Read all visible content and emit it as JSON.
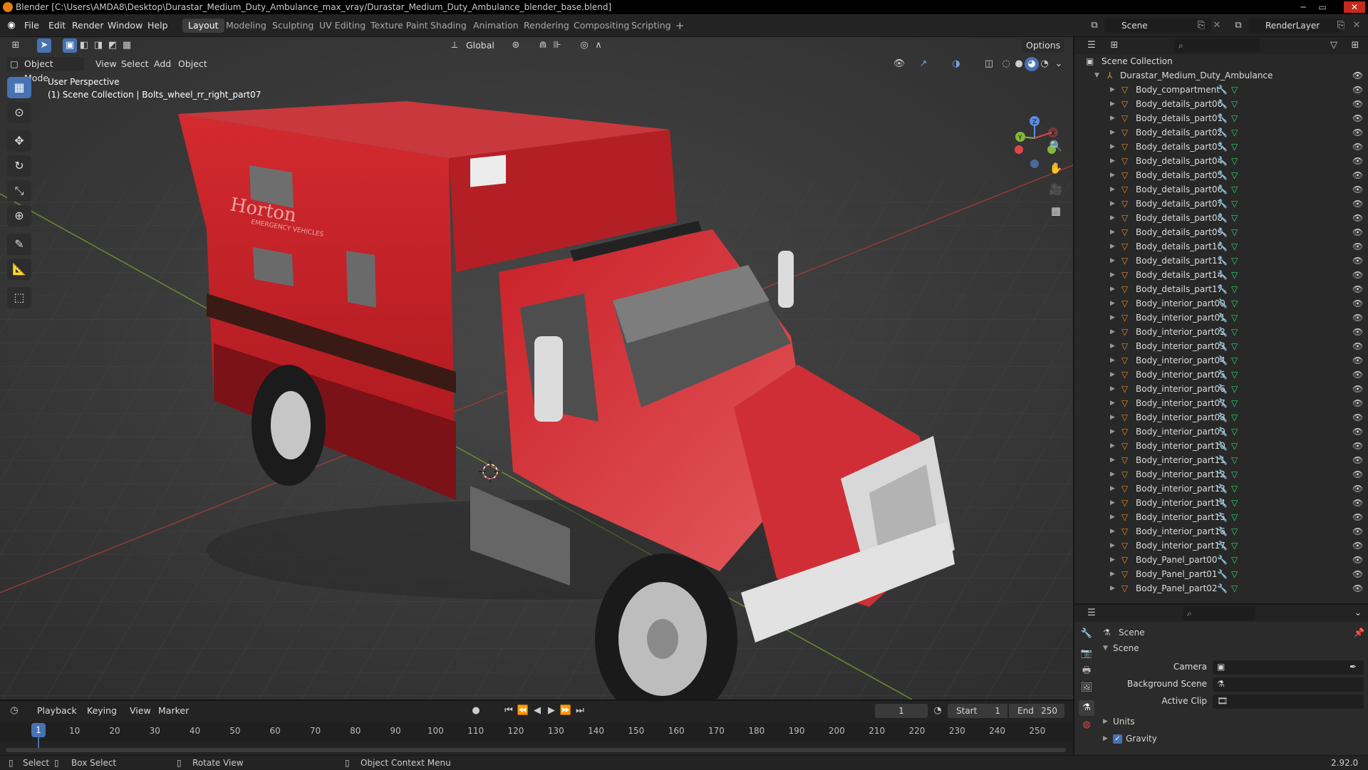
{
  "app": {
    "title": "Blender [C:\\Users\\AMDA8\\Desktop\\Durastar_Medium_Duty_Ambulance_max_vray/Durastar_Medium_Duty_Ambulance_blender_base.blend]",
    "version": "2.92.0"
  },
  "menus": [
    "File",
    "Edit",
    "Render",
    "Window",
    "Help"
  ],
  "workspaces": [
    "Layout",
    "Modeling",
    "Sculpting",
    "UV Editing",
    "Texture Paint",
    "Shading",
    "Animation",
    "Rendering",
    "Compositing",
    "Scripting"
  ],
  "active_workspace": "Layout",
  "scene_field": "Scene",
  "renderlayer_field": "RenderLayer",
  "viewport": {
    "mode": "Object Mode",
    "menus": [
      "View",
      "Select",
      "Add",
      "Object"
    ],
    "transform_orientation": "Global",
    "options_label": "Options",
    "overlay_line1": "User Perspective",
    "overlay_line2": "(1) Scene Collection | Bolts_wheel_rr_right_part07",
    "truck_text": "Horton",
    "truck_subtext": "EMERGENCY VEHICLES",
    "gizmo_axes": {
      "x": "X",
      "y": "Y",
      "z": "Z"
    }
  },
  "colors": {
    "accent": "#4772b3",
    "mesh_icon": "#e08a2a",
    "vertex_icon": "#2fd57a",
    "modifier_icon": "#6ea3dd",
    "playhead": "#4772b3",
    "ambulance_red": "#c9242a"
  },
  "outliner": {
    "root": "Scene Collection",
    "collection": "Durastar_Medium_Duty_Ambulance",
    "items": [
      "Body_compartment",
      "Body_details_part00",
      "Body_details_part01",
      "Body_details_part02",
      "Body_details_part03",
      "Body_details_part04",
      "Body_details_part05",
      "Body_details_part06",
      "Body_details_part07",
      "Body_details_part08",
      "Body_details_part09",
      "Body_details_part10",
      "Body_details_part11",
      "Body_details_part14",
      "Body_details_part17",
      "Body_interior_part00",
      "Body_interior_part01",
      "Body_interior_part02",
      "Body_interior_part03",
      "Body_interior_part04",
      "Body_interior_part05",
      "Body_interior_part06",
      "Body_interior_part07",
      "Body_interior_part08",
      "Body_interior_part09",
      "Body_interior_part10",
      "Body_interior_part11",
      "Body_interior_part12",
      "Body_interior_part13",
      "Body_interior_part14",
      "Body_interior_part15",
      "Body_interior_part16",
      "Body_interior_part17",
      "Body_Panel_part00",
      "Body_Panel_part01",
      "Body_Panel_part02"
    ]
  },
  "properties": {
    "header": "Scene",
    "panel": "Scene",
    "fields": [
      {
        "label": "Camera"
      },
      {
        "label": "Background Scene"
      },
      {
        "label": "Active Clip"
      }
    ],
    "subpanels": [
      "Units",
      "Gravity"
    ],
    "gravity_checked": true
  },
  "timeline": {
    "menus": [
      "Playback",
      "Keying",
      "View",
      "Marker"
    ],
    "current_frame": "1",
    "start_label": "Start",
    "start": "1",
    "end_label": "End",
    "end": "250",
    "ticks": [
      "1",
      "10",
      "20",
      "30",
      "40",
      "50",
      "60",
      "70",
      "80",
      "90",
      "100",
      "110",
      "120",
      "130",
      "140",
      "150",
      "160",
      "170",
      "180",
      "190",
      "200",
      "210",
      "220",
      "230",
      "240",
      "250"
    ]
  },
  "statusbar": {
    "items": [
      "Select",
      "Box Select",
      "Rotate View",
      "Object Context Menu"
    ]
  }
}
